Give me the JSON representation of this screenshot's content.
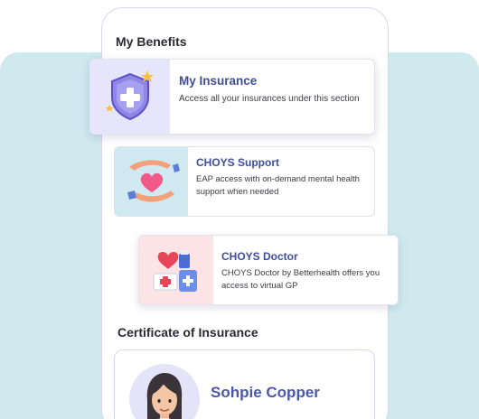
{
  "benefits": {
    "section_title": "My Benefits",
    "cards": [
      {
        "title": "My Insurance",
        "description": "Access all your insurances under this section",
        "icon": "insurance-shield-icon"
      },
      {
        "title": "CHOYS Support",
        "description": "EAP access with on-demand mental health support when needed",
        "icon": "heart-hands-icon"
      },
      {
        "title": "CHOYS Doctor",
        "description": "CHOYS Doctor by Betterhealth offers you access to virtual GP",
        "icon": "medical-kit-icon"
      }
    ]
  },
  "certificate": {
    "section_title": "Certificate of Insurance",
    "holder_name": "Sohpie Copper"
  },
  "colors": {
    "accent": "#3f4d9c",
    "background_teal": "#cfe9ee",
    "insurance_thumb": "#e6e5fb",
    "support_thumb": "#d1eaf1",
    "doctor_thumb": "#fbe3e6"
  }
}
